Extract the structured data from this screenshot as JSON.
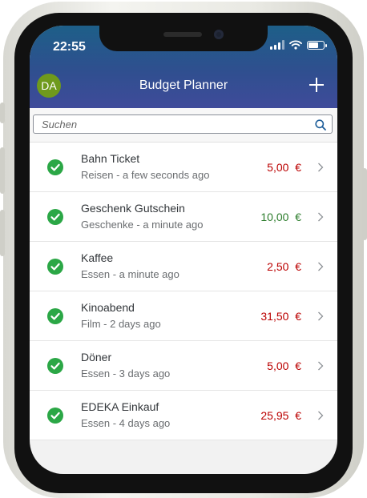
{
  "status": {
    "time": "22:55"
  },
  "header": {
    "avatar_initials": "DA",
    "title": "Budget Planner",
    "add_icon": "plus-icon"
  },
  "search": {
    "placeholder": "Suchen",
    "value": ""
  },
  "colors": {
    "negative": "#bb0000",
    "positive": "#2b7c2b",
    "check": "#2ba746"
  },
  "items": [
    {
      "title": "Bahn Ticket",
      "subtitle": "Reisen - a few seconds ago",
      "amount": "5,00  €",
      "type": "expense"
    },
    {
      "title": "Geschenk Gutschein",
      "subtitle": "Geschenke - a minute ago",
      "amount": "10,00  €",
      "type": "income"
    },
    {
      "title": "Kaffee",
      "subtitle": "Essen - a minute ago",
      "amount": "2,50  €",
      "type": "expense"
    },
    {
      "title": "Kinoabend",
      "subtitle": "Film - 2 days ago",
      "amount": "31,50  €",
      "type": "expense"
    },
    {
      "title": "Döner",
      "subtitle": "Essen - 3 days ago",
      "amount": "5,00  €",
      "type": "expense"
    },
    {
      "title": "EDEKA Einkauf",
      "subtitle": "Essen - 4 days ago",
      "amount": "25,95  €",
      "type": "expense"
    }
  ]
}
